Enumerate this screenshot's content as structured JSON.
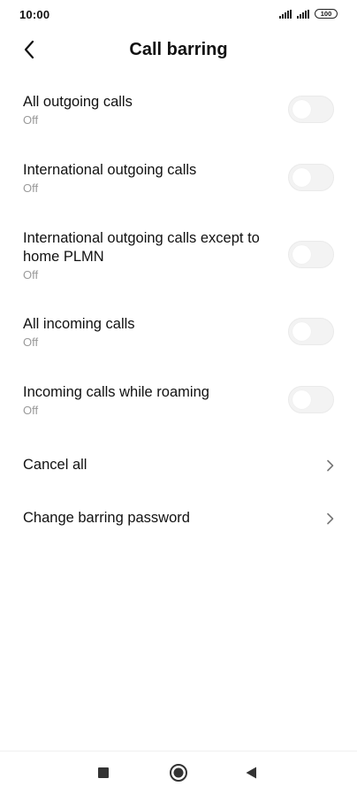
{
  "status_bar": {
    "time": "10:00",
    "battery": "100",
    "signal_icons": [
      "signal-icon",
      "signal-icon"
    ]
  },
  "header": {
    "back_icon": "chevron-left-icon",
    "title": "Call barring"
  },
  "items": [
    {
      "title": "All outgoing calls",
      "subtitle": "Off",
      "control": "toggle",
      "checked": false
    },
    {
      "title": "International outgoing calls",
      "subtitle": "Off",
      "control": "toggle",
      "checked": false
    },
    {
      "title": "International outgoing calls except to home PLMN",
      "subtitle": "Off",
      "control": "toggle",
      "checked": false
    },
    {
      "title": "All incoming calls",
      "subtitle": "Off",
      "control": "toggle",
      "checked": false
    },
    {
      "title": "Incoming calls while roaming",
      "subtitle": "Off",
      "control": "toggle",
      "checked": false
    },
    {
      "title": "Cancel all",
      "control": "chevron"
    },
    {
      "title": "Change barring password",
      "control": "chevron"
    }
  ],
  "nav_bar": {
    "buttons": [
      "recents-square-icon",
      "home-circle-icon",
      "back-triangle-icon"
    ]
  },
  "colors": {
    "text_primary": "#111111",
    "text_secondary": "#9a9a9a",
    "toggle_off_track": "#f3f3f3",
    "background": "#ffffff"
  }
}
